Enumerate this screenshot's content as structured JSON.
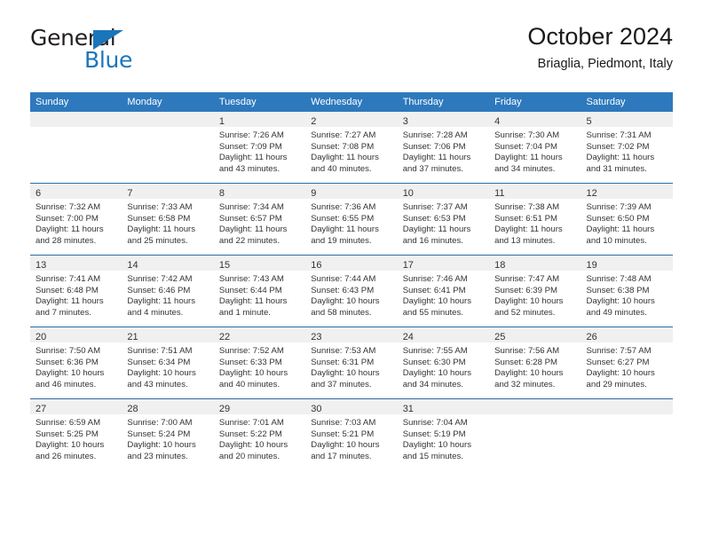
{
  "logo": {
    "word1": "General",
    "word2": "Blue",
    "flag_icon": "triangle-flag-icon",
    "color_dark": "#231f20",
    "color_blue": "#1b75bb"
  },
  "header": {
    "title": "October 2024",
    "subtitle": "Briaglia, Piedmont, Italy"
  },
  "colors": {
    "header_row_bg": "#2e79bd",
    "row_divider": "#2e6da4",
    "daynum_bar_bg": "#f0f0f0",
    "text": "#333333"
  },
  "calendar": {
    "weekday_headers": [
      "Sunday",
      "Monday",
      "Tuesday",
      "Wednesday",
      "Thursday",
      "Friday",
      "Saturday"
    ],
    "weeks": [
      [
        {
          "day": "",
          "empty": true
        },
        {
          "day": "",
          "empty": true
        },
        {
          "day": "1",
          "sunrise": "Sunrise: 7:26 AM",
          "sunset": "Sunset: 7:09 PM",
          "daylight_line1": "Daylight: 11 hours",
          "daylight_line2": "and 43 minutes."
        },
        {
          "day": "2",
          "sunrise": "Sunrise: 7:27 AM",
          "sunset": "Sunset: 7:08 PM",
          "daylight_line1": "Daylight: 11 hours",
          "daylight_line2": "and 40 minutes."
        },
        {
          "day": "3",
          "sunrise": "Sunrise: 7:28 AM",
          "sunset": "Sunset: 7:06 PM",
          "daylight_line1": "Daylight: 11 hours",
          "daylight_line2": "and 37 minutes."
        },
        {
          "day": "4",
          "sunrise": "Sunrise: 7:30 AM",
          "sunset": "Sunset: 7:04 PM",
          "daylight_line1": "Daylight: 11 hours",
          "daylight_line2": "and 34 minutes."
        },
        {
          "day": "5",
          "sunrise": "Sunrise: 7:31 AM",
          "sunset": "Sunset: 7:02 PM",
          "daylight_line1": "Daylight: 11 hours",
          "daylight_line2": "and 31 minutes."
        }
      ],
      [
        {
          "day": "6",
          "sunrise": "Sunrise: 7:32 AM",
          "sunset": "Sunset: 7:00 PM",
          "daylight_line1": "Daylight: 11 hours",
          "daylight_line2": "and 28 minutes."
        },
        {
          "day": "7",
          "sunrise": "Sunrise: 7:33 AM",
          "sunset": "Sunset: 6:58 PM",
          "daylight_line1": "Daylight: 11 hours",
          "daylight_line2": "and 25 minutes."
        },
        {
          "day": "8",
          "sunrise": "Sunrise: 7:34 AM",
          "sunset": "Sunset: 6:57 PM",
          "daylight_line1": "Daylight: 11 hours",
          "daylight_line2": "and 22 minutes."
        },
        {
          "day": "9",
          "sunrise": "Sunrise: 7:36 AM",
          "sunset": "Sunset: 6:55 PM",
          "daylight_line1": "Daylight: 11 hours",
          "daylight_line2": "and 19 minutes."
        },
        {
          "day": "10",
          "sunrise": "Sunrise: 7:37 AM",
          "sunset": "Sunset: 6:53 PM",
          "daylight_line1": "Daylight: 11 hours",
          "daylight_line2": "and 16 minutes."
        },
        {
          "day": "11",
          "sunrise": "Sunrise: 7:38 AM",
          "sunset": "Sunset: 6:51 PM",
          "daylight_line1": "Daylight: 11 hours",
          "daylight_line2": "and 13 minutes."
        },
        {
          "day": "12",
          "sunrise": "Sunrise: 7:39 AM",
          "sunset": "Sunset: 6:50 PM",
          "daylight_line1": "Daylight: 11 hours",
          "daylight_line2": "and 10 minutes."
        }
      ],
      [
        {
          "day": "13",
          "sunrise": "Sunrise: 7:41 AM",
          "sunset": "Sunset: 6:48 PM",
          "daylight_line1": "Daylight: 11 hours",
          "daylight_line2": "and 7 minutes."
        },
        {
          "day": "14",
          "sunrise": "Sunrise: 7:42 AM",
          "sunset": "Sunset: 6:46 PM",
          "daylight_line1": "Daylight: 11 hours",
          "daylight_line2": "and 4 minutes."
        },
        {
          "day": "15",
          "sunrise": "Sunrise: 7:43 AM",
          "sunset": "Sunset: 6:44 PM",
          "daylight_line1": "Daylight: 11 hours",
          "daylight_line2": "and 1 minute."
        },
        {
          "day": "16",
          "sunrise": "Sunrise: 7:44 AM",
          "sunset": "Sunset: 6:43 PM",
          "daylight_line1": "Daylight: 10 hours",
          "daylight_line2": "and 58 minutes."
        },
        {
          "day": "17",
          "sunrise": "Sunrise: 7:46 AM",
          "sunset": "Sunset: 6:41 PM",
          "daylight_line1": "Daylight: 10 hours",
          "daylight_line2": "and 55 minutes."
        },
        {
          "day": "18",
          "sunrise": "Sunrise: 7:47 AM",
          "sunset": "Sunset: 6:39 PM",
          "daylight_line1": "Daylight: 10 hours",
          "daylight_line2": "and 52 minutes."
        },
        {
          "day": "19",
          "sunrise": "Sunrise: 7:48 AM",
          "sunset": "Sunset: 6:38 PM",
          "daylight_line1": "Daylight: 10 hours",
          "daylight_line2": "and 49 minutes."
        }
      ],
      [
        {
          "day": "20",
          "sunrise": "Sunrise: 7:50 AM",
          "sunset": "Sunset: 6:36 PM",
          "daylight_line1": "Daylight: 10 hours",
          "daylight_line2": "and 46 minutes."
        },
        {
          "day": "21",
          "sunrise": "Sunrise: 7:51 AM",
          "sunset": "Sunset: 6:34 PM",
          "daylight_line1": "Daylight: 10 hours",
          "daylight_line2": "and 43 minutes."
        },
        {
          "day": "22",
          "sunrise": "Sunrise: 7:52 AM",
          "sunset": "Sunset: 6:33 PM",
          "daylight_line1": "Daylight: 10 hours",
          "daylight_line2": "and 40 minutes."
        },
        {
          "day": "23",
          "sunrise": "Sunrise: 7:53 AM",
          "sunset": "Sunset: 6:31 PM",
          "daylight_line1": "Daylight: 10 hours",
          "daylight_line2": "and 37 minutes."
        },
        {
          "day": "24",
          "sunrise": "Sunrise: 7:55 AM",
          "sunset": "Sunset: 6:30 PM",
          "daylight_line1": "Daylight: 10 hours",
          "daylight_line2": "and 34 minutes."
        },
        {
          "day": "25",
          "sunrise": "Sunrise: 7:56 AM",
          "sunset": "Sunset: 6:28 PM",
          "daylight_line1": "Daylight: 10 hours",
          "daylight_line2": "and 32 minutes."
        },
        {
          "day": "26",
          "sunrise": "Sunrise: 7:57 AM",
          "sunset": "Sunset: 6:27 PM",
          "daylight_line1": "Daylight: 10 hours",
          "daylight_line2": "and 29 minutes."
        }
      ],
      [
        {
          "day": "27",
          "sunrise": "Sunrise: 6:59 AM",
          "sunset": "Sunset: 5:25 PM",
          "daylight_line1": "Daylight: 10 hours",
          "daylight_line2": "and 26 minutes."
        },
        {
          "day": "28",
          "sunrise": "Sunrise: 7:00 AM",
          "sunset": "Sunset: 5:24 PM",
          "daylight_line1": "Daylight: 10 hours",
          "daylight_line2": "and 23 minutes."
        },
        {
          "day": "29",
          "sunrise": "Sunrise: 7:01 AM",
          "sunset": "Sunset: 5:22 PM",
          "daylight_line1": "Daylight: 10 hours",
          "daylight_line2": "and 20 minutes."
        },
        {
          "day": "30",
          "sunrise": "Sunrise: 7:03 AM",
          "sunset": "Sunset: 5:21 PM",
          "daylight_line1": "Daylight: 10 hours",
          "daylight_line2": "and 17 minutes."
        },
        {
          "day": "31",
          "sunrise": "Sunrise: 7:04 AM",
          "sunset": "Sunset: 5:19 PM",
          "daylight_line1": "Daylight: 10 hours",
          "daylight_line2": "and 15 minutes."
        },
        {
          "day": "",
          "empty": true
        },
        {
          "day": "",
          "empty": true
        }
      ]
    ]
  }
}
